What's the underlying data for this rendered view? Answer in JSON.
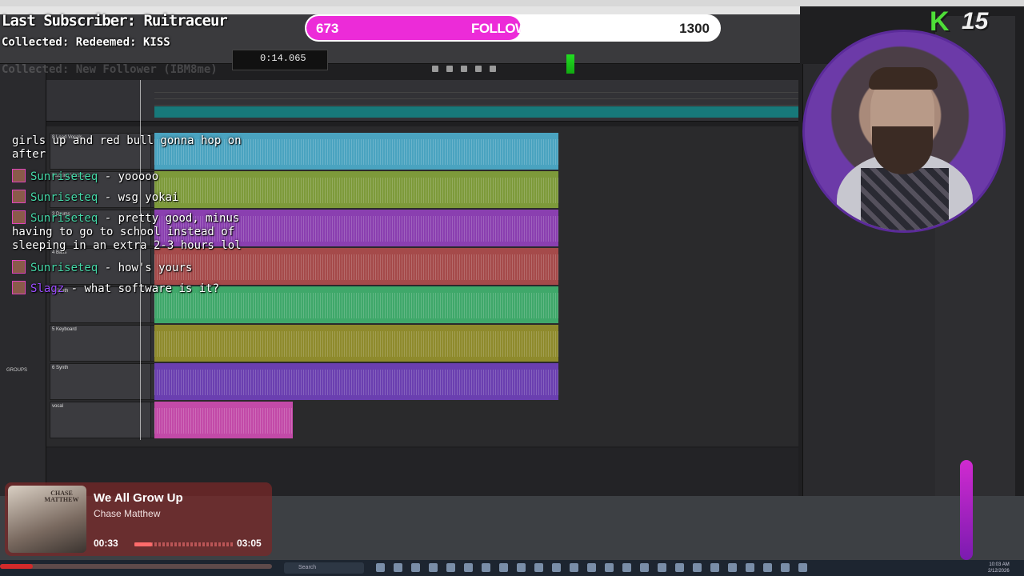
{
  "overlay": {
    "last_subscriber": "Last Subscriber: Ruitraceur",
    "collected": "Collected: Redeemed: KISS",
    "collected_ghost": "Collected: New Follower (IBM8me)"
  },
  "followers_goal": {
    "current": "673",
    "label": "FOLLOWERS",
    "target": "1300",
    "progress_fraction": 0.52,
    "fill_color": "#ec2bd8"
  },
  "chat": {
    "messages": [
      {
        "user": "",
        "text": "girls up and red bull gonna hop on"
      },
      {
        "user": "",
        "text": "after"
      },
      {
        "user": "Sunriseteq",
        "sep": " - ",
        "text": "yooooo"
      },
      {
        "user": "Sunriseteq",
        "sep": " - ",
        "text": "wsg yokai"
      },
      {
        "user": "Sunriseteq",
        "sep": " - ",
        "text": "pretty good, minus"
      },
      {
        "user": "",
        "text": "having to go to school instead of"
      },
      {
        "user": "",
        "text": "sleeping in an extra 2-3 hours lol"
      },
      {
        "user": "Sunriseteq",
        "sep": " - ",
        "text": "how's yours"
      },
      {
        "user": "Slagz",
        "sep": " - ",
        "text": "what software is it?"
      }
    ]
  },
  "channel_badge": {
    "letter": "K",
    "number": "15"
  },
  "protools": {
    "counter": "0:14.065",
    "groups_label": "GROUPS",
    "tracks": [
      {
        "name": "8 Lead Vocals",
        "color": "#4aa3c0"
      },
      {
        "name": "Backing Vocals",
        "color": "#7d9a3a"
      },
      {
        "name": "3 Drums",
        "color": "#8a3fb0"
      },
      {
        "name": "4 Bass",
        "color": "#a54a4a"
      },
      {
        "name": "4 Synth",
        "color": "#3fa86a"
      },
      {
        "name": "5 Keyboard",
        "color": "#8e8a2c"
      },
      {
        "name": "6 Synth",
        "color": "#6a3fb0"
      },
      {
        "name": "vocal",
        "color": "#c24aa8"
      }
    ]
  },
  "now_playing": {
    "title": "We All Grow Up",
    "artist": "Chase Matthew",
    "elapsed": "00:33",
    "duration": "03:05",
    "progress_fraction": 0.18,
    "art_text": "CHASE MATTHEW"
  },
  "taskbar": {
    "search_placeholder": "Search",
    "clock_time": "10:03 AM",
    "clock_date": "2/12/2026",
    "media_progress_fraction": 0.12
  }
}
